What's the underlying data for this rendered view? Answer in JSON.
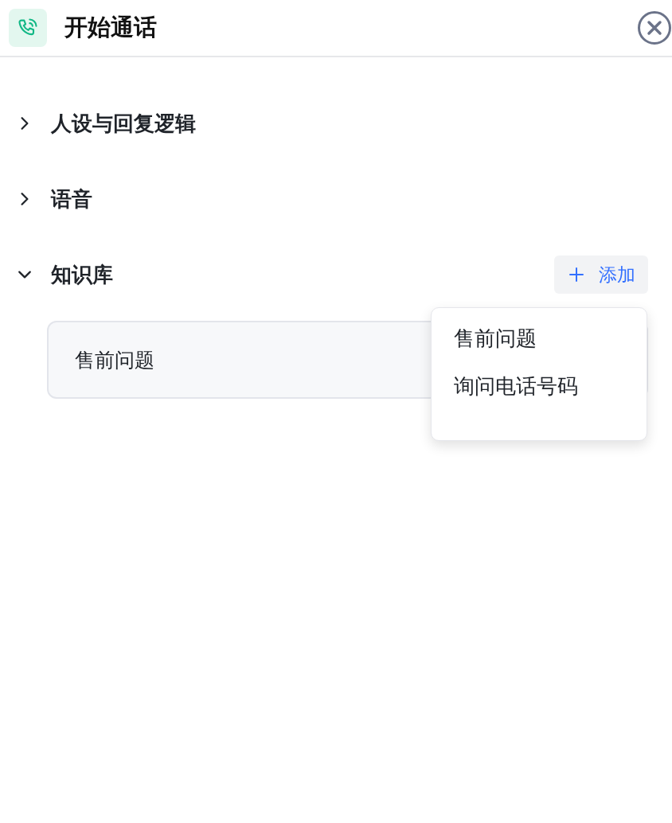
{
  "header": {
    "title": "开始通话"
  },
  "sections": [
    {
      "title": "人设与回复逻辑",
      "expanded": false
    },
    {
      "title": "语音",
      "expanded": false
    },
    {
      "title": "知识库",
      "expanded": true,
      "add_button": "添加",
      "items": [
        "售前问题"
      ]
    }
  ],
  "dropdown": {
    "items": [
      "售前问题",
      "询问电话号码"
    ]
  }
}
